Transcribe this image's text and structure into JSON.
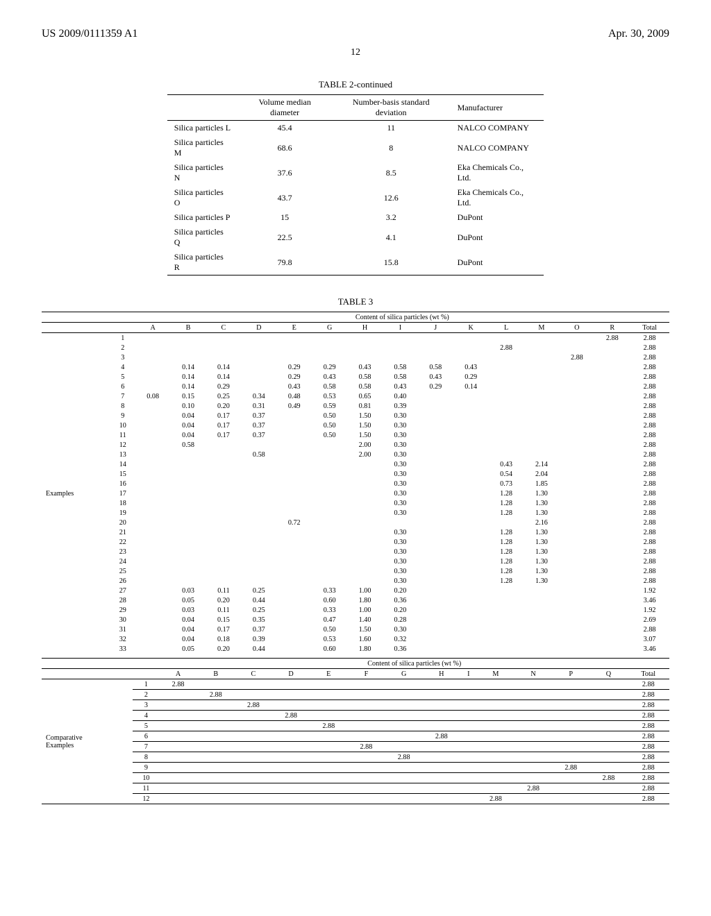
{
  "header": {
    "pubno": "US 2009/0111359 A1",
    "date": "Apr. 30, 2009",
    "page": "12"
  },
  "table2": {
    "caption": "TABLE 2-continued",
    "cols": [
      "",
      "Volume median diameter",
      "Number-basis standard deviation",
      "Manufacturer"
    ],
    "rows": [
      [
        "Silica particles L",
        "45.4",
        "11",
        "NALCO COMPANY"
      ],
      [
        "Silica particles M",
        "68.6",
        "8",
        "NALCO COMPANY"
      ],
      [
        "Silica particles N",
        "37.6",
        "8.5",
        "Eka Chemicals Co., Ltd."
      ],
      [
        "Silica particles O",
        "43.7",
        "12.6",
        "Eka Chemicals Co., Ltd."
      ],
      [
        "Silica particles P",
        "15",
        "3.2",
        "DuPont"
      ],
      [
        "Silica particles Q",
        "22.5",
        "4.1",
        "DuPont"
      ],
      [
        "Silica particles R",
        "79.8",
        "15.8",
        "DuPont"
      ]
    ]
  },
  "chart_data": {
    "type": "table",
    "title": "TABLE 3",
    "upper": {
      "group_label": "Content of silica particles (wt %)",
      "row_label": "Examples",
      "cols": [
        "A",
        "B",
        "C",
        "D",
        "E",
        "G",
        "H",
        "I",
        "J",
        "K",
        "L",
        "M",
        "O",
        "R",
        "Total"
      ],
      "rows": [
        {
          "n": "1",
          "v": {
            "R": "2.88",
            "Total": "2.88"
          }
        },
        {
          "n": "2",
          "v": {
            "L": "2.88",
            "Total": "2.88"
          }
        },
        {
          "n": "3",
          "v": {
            "O": "2.88",
            "Total": "2.88"
          }
        },
        {
          "n": "4",
          "v": {
            "B": "0.14",
            "C": "0.14",
            "E": "0.29",
            "G": "0.29",
            "H": "0.43",
            "I": "0.58",
            "J": "0.58",
            "K": "0.43",
            "Total": "2.88"
          }
        },
        {
          "n": "5",
          "v": {
            "B": "0.14",
            "C": "0.14",
            "E": "0.29",
            "G": "0.43",
            "H": "0.58",
            "I": "0.58",
            "J": "0.43",
            "K": "0.29",
            "Total": "2.88"
          }
        },
        {
          "n": "6",
          "v": {
            "B": "0.14",
            "C": "0.29",
            "E": "0.43",
            "G": "0.58",
            "H": "0.58",
            "I": "0.43",
            "J": "0.29",
            "K": "0.14",
            "Total": "2.88"
          }
        },
        {
          "n": "7",
          "v": {
            "A": "0.08",
            "B": "0.15",
            "C": "0.25",
            "D": "0.34",
            "E": "0.48",
            "G": "0.53",
            "H": "0.65",
            "I": "0.40",
            "Total": "2.88"
          }
        },
        {
          "n": "8",
          "v": {
            "B": "0.10",
            "C": "0.20",
            "D": "0.31",
            "E": "0.49",
            "G": "0.59",
            "H": "0.81",
            "I": "0.39",
            "Total": "2.88"
          }
        },
        {
          "n": "9",
          "v": {
            "B": "0.04",
            "C": "0.17",
            "D": "0.37",
            "G": "0.50",
            "H": "1.50",
            "I": "0.30",
            "Total": "2.88"
          }
        },
        {
          "n": "10",
          "v": {
            "B": "0.04",
            "C": "0.17",
            "D": "0.37",
            "G": "0.50",
            "H": "1.50",
            "I": "0.30",
            "Total": "2.88"
          }
        },
        {
          "n": "11",
          "v": {
            "B": "0.04",
            "C": "0.17",
            "D": "0.37",
            "G": "0.50",
            "H": "1.50",
            "I": "0.30",
            "Total": "2.88"
          }
        },
        {
          "n": "12",
          "v": {
            "B": "0.58",
            "H": "2.00",
            "I": "0.30",
            "Total": "2.88"
          }
        },
        {
          "n": "13",
          "v": {
            "D": "0.58",
            "H": "2.00",
            "I": "0.30",
            "Total": "2.88"
          }
        },
        {
          "n": "14",
          "v": {
            "I": "0.30",
            "L": "0.43",
            "M": "2.14",
            "Total": "2.88"
          }
        },
        {
          "n": "15",
          "v": {
            "I": "0.30",
            "L": "0.54",
            "M": "2.04",
            "Total": "2.88"
          }
        },
        {
          "n": "16",
          "v": {
            "I": "0.30",
            "L": "0.73",
            "M": "1.85",
            "Total": "2.88"
          }
        },
        {
          "n": "17",
          "v": {
            "I": "0.30",
            "L": "1.28",
            "M": "1.30",
            "Total": "2.88"
          }
        },
        {
          "n": "18",
          "v": {
            "I": "0.30",
            "L": "1.28",
            "M": "1.30",
            "Total": "2.88"
          }
        },
        {
          "n": "19",
          "v": {
            "I": "0.30",
            "L": "1.28",
            "M": "1.30",
            "Total": "2.88"
          }
        },
        {
          "n": "20",
          "v": {
            "E": "0.72",
            "M": "2.16",
            "Total": "2.88"
          }
        },
        {
          "n": "21",
          "v": {
            "I": "0.30",
            "L": "1.28",
            "M": "1.30",
            "Total": "2.88"
          }
        },
        {
          "n": "22",
          "v": {
            "I": "0.30",
            "L": "1.28",
            "M": "1.30",
            "Total": "2.88"
          }
        },
        {
          "n": "23",
          "v": {
            "I": "0.30",
            "L": "1.28",
            "M": "1.30",
            "Total": "2.88"
          }
        },
        {
          "n": "24",
          "v": {
            "I": "0.30",
            "L": "1.28",
            "M": "1.30",
            "Total": "2.88"
          }
        },
        {
          "n": "25",
          "v": {
            "I": "0.30",
            "L": "1.28",
            "M": "1.30",
            "Total": "2.88"
          }
        },
        {
          "n": "26",
          "v": {
            "I": "0.30",
            "L": "1.28",
            "M": "1.30",
            "Total": "2.88"
          }
        },
        {
          "n": "27",
          "v": {
            "B": "0.03",
            "C": "0.11",
            "D": "0.25",
            "G": "0.33",
            "H": "1.00",
            "I": "0.20",
            "Total": "1.92"
          }
        },
        {
          "n": "28",
          "v": {
            "B": "0.05",
            "C": "0.20",
            "D": "0.44",
            "G": "0.60",
            "H": "1.80",
            "I": "0.36",
            "Total": "3.46"
          }
        },
        {
          "n": "29",
          "v": {
            "B": "0.03",
            "C": "0.11",
            "D": "0.25",
            "G": "0.33",
            "H": "1.00",
            "I": "0.20",
            "Total": "1.92"
          }
        },
        {
          "n": "30",
          "v": {
            "B": "0.04",
            "C": "0.15",
            "D": "0.35",
            "G": "0.47",
            "H": "1.40",
            "I": "0.28",
            "Total": "2.69"
          }
        },
        {
          "n": "31",
          "v": {
            "B": "0.04",
            "C": "0.17",
            "D": "0.37",
            "G": "0.50",
            "H": "1.50",
            "I": "0.30",
            "Total": "2.88"
          }
        },
        {
          "n": "32",
          "v": {
            "B": "0.04",
            "C": "0.18",
            "D": "0.39",
            "G": "0.53",
            "H": "1.60",
            "I": "0.32",
            "Total": "3.07"
          }
        },
        {
          "n": "33",
          "v": {
            "B": "0.05",
            "C": "0.20",
            "D": "0.44",
            "G": "0.60",
            "H": "1.80",
            "I": "0.36",
            "Total": "3.46"
          }
        }
      ]
    },
    "lower": {
      "group_label": "Content of silica particles (wt %)",
      "row_label": "Comparative Examples",
      "cols": [
        "A",
        "B",
        "C",
        "D",
        "E",
        "F",
        "G",
        "H",
        "I",
        "M",
        "N",
        "P",
        "Q",
        "Total"
      ],
      "rows": [
        {
          "n": "1",
          "v": {
            "A": "2.88",
            "Total": "2.88"
          }
        },
        {
          "n": "2",
          "v": {
            "B": "2.88",
            "Total": "2.88"
          }
        },
        {
          "n": "3",
          "v": {
            "C": "2.88",
            "Total": "2.88"
          }
        },
        {
          "n": "4",
          "v": {
            "D": "2.88",
            "Total": "2.88"
          }
        },
        {
          "n": "5",
          "v": {
            "E": "2.88",
            "Total": "2.88"
          }
        },
        {
          "n": "6",
          "v": {
            "H": "2.88",
            "Total": "2.88"
          }
        },
        {
          "n": "7",
          "v": {
            "F": "2.88",
            "Total": "2.88"
          }
        },
        {
          "n": "8",
          "v": {
            "G": "2.88",
            "Total": "2.88"
          }
        },
        {
          "n": "9",
          "v": {
            "P": "2.88",
            "Total": "2.88"
          }
        },
        {
          "n": "10",
          "v": {
            "Q": "2.88",
            "Total": "2.88"
          }
        },
        {
          "n": "11",
          "v": {
            "N": "2.88",
            "Total": "2.88"
          }
        },
        {
          "n": "12",
          "v": {
            "M": "2.88",
            "Total": "2.88"
          }
        }
      ]
    }
  }
}
